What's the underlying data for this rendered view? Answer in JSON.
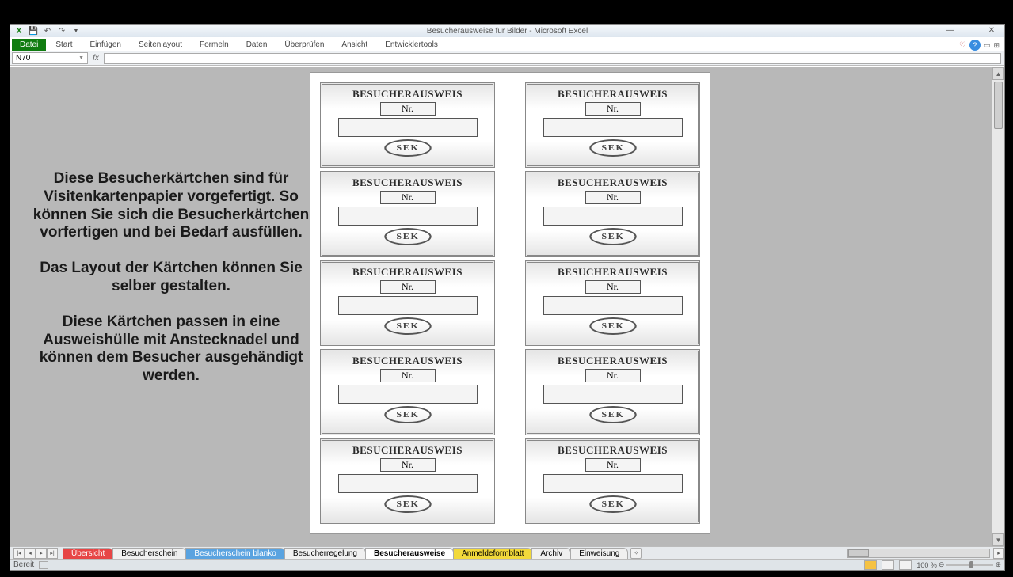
{
  "title": "Besucherausweise für Bilder - Microsoft Excel",
  "ribbon": {
    "file": "Datei",
    "tabs": [
      "Start",
      "Einfügen",
      "Seitenlayout",
      "Formeln",
      "Daten",
      "Überprüfen",
      "Ansicht",
      "Entwicklertools"
    ]
  },
  "namebox": "N70",
  "info": {
    "p1": "Diese Besucherkärtchen sind für Visitenkartenpapier vorgefertigt. So können Sie sich die Besucherkärtchen vorfertigen und bei Bedarf ausfüllen.",
    "p2": "Das Layout der Kärtchen können Sie selber gestalten.",
    "p3": "Diese Kärtchen passen in eine Ausweishülle mit Anstecknadel und können dem Besucher ausgehändigt werden."
  },
  "card": {
    "title": "BESUCHERAUSWEIS",
    "nr": "Nr.",
    "stamp": "SEK"
  },
  "sheets": [
    {
      "label": "Übersicht",
      "cls": "red"
    },
    {
      "label": "Besucherschein",
      "cls": ""
    },
    {
      "label": "Besucherschein blanko",
      "cls": "blue"
    },
    {
      "label": "Besucherregelung",
      "cls": ""
    },
    {
      "label": "Besucherausweise",
      "cls": "active"
    },
    {
      "label": "Anmeldeformblatt",
      "cls": "yellow"
    },
    {
      "label": "Archiv",
      "cls": ""
    },
    {
      "label": "Einweisung",
      "cls": ""
    }
  ],
  "status": {
    "ready": "Bereit",
    "zoom": "100 %"
  }
}
